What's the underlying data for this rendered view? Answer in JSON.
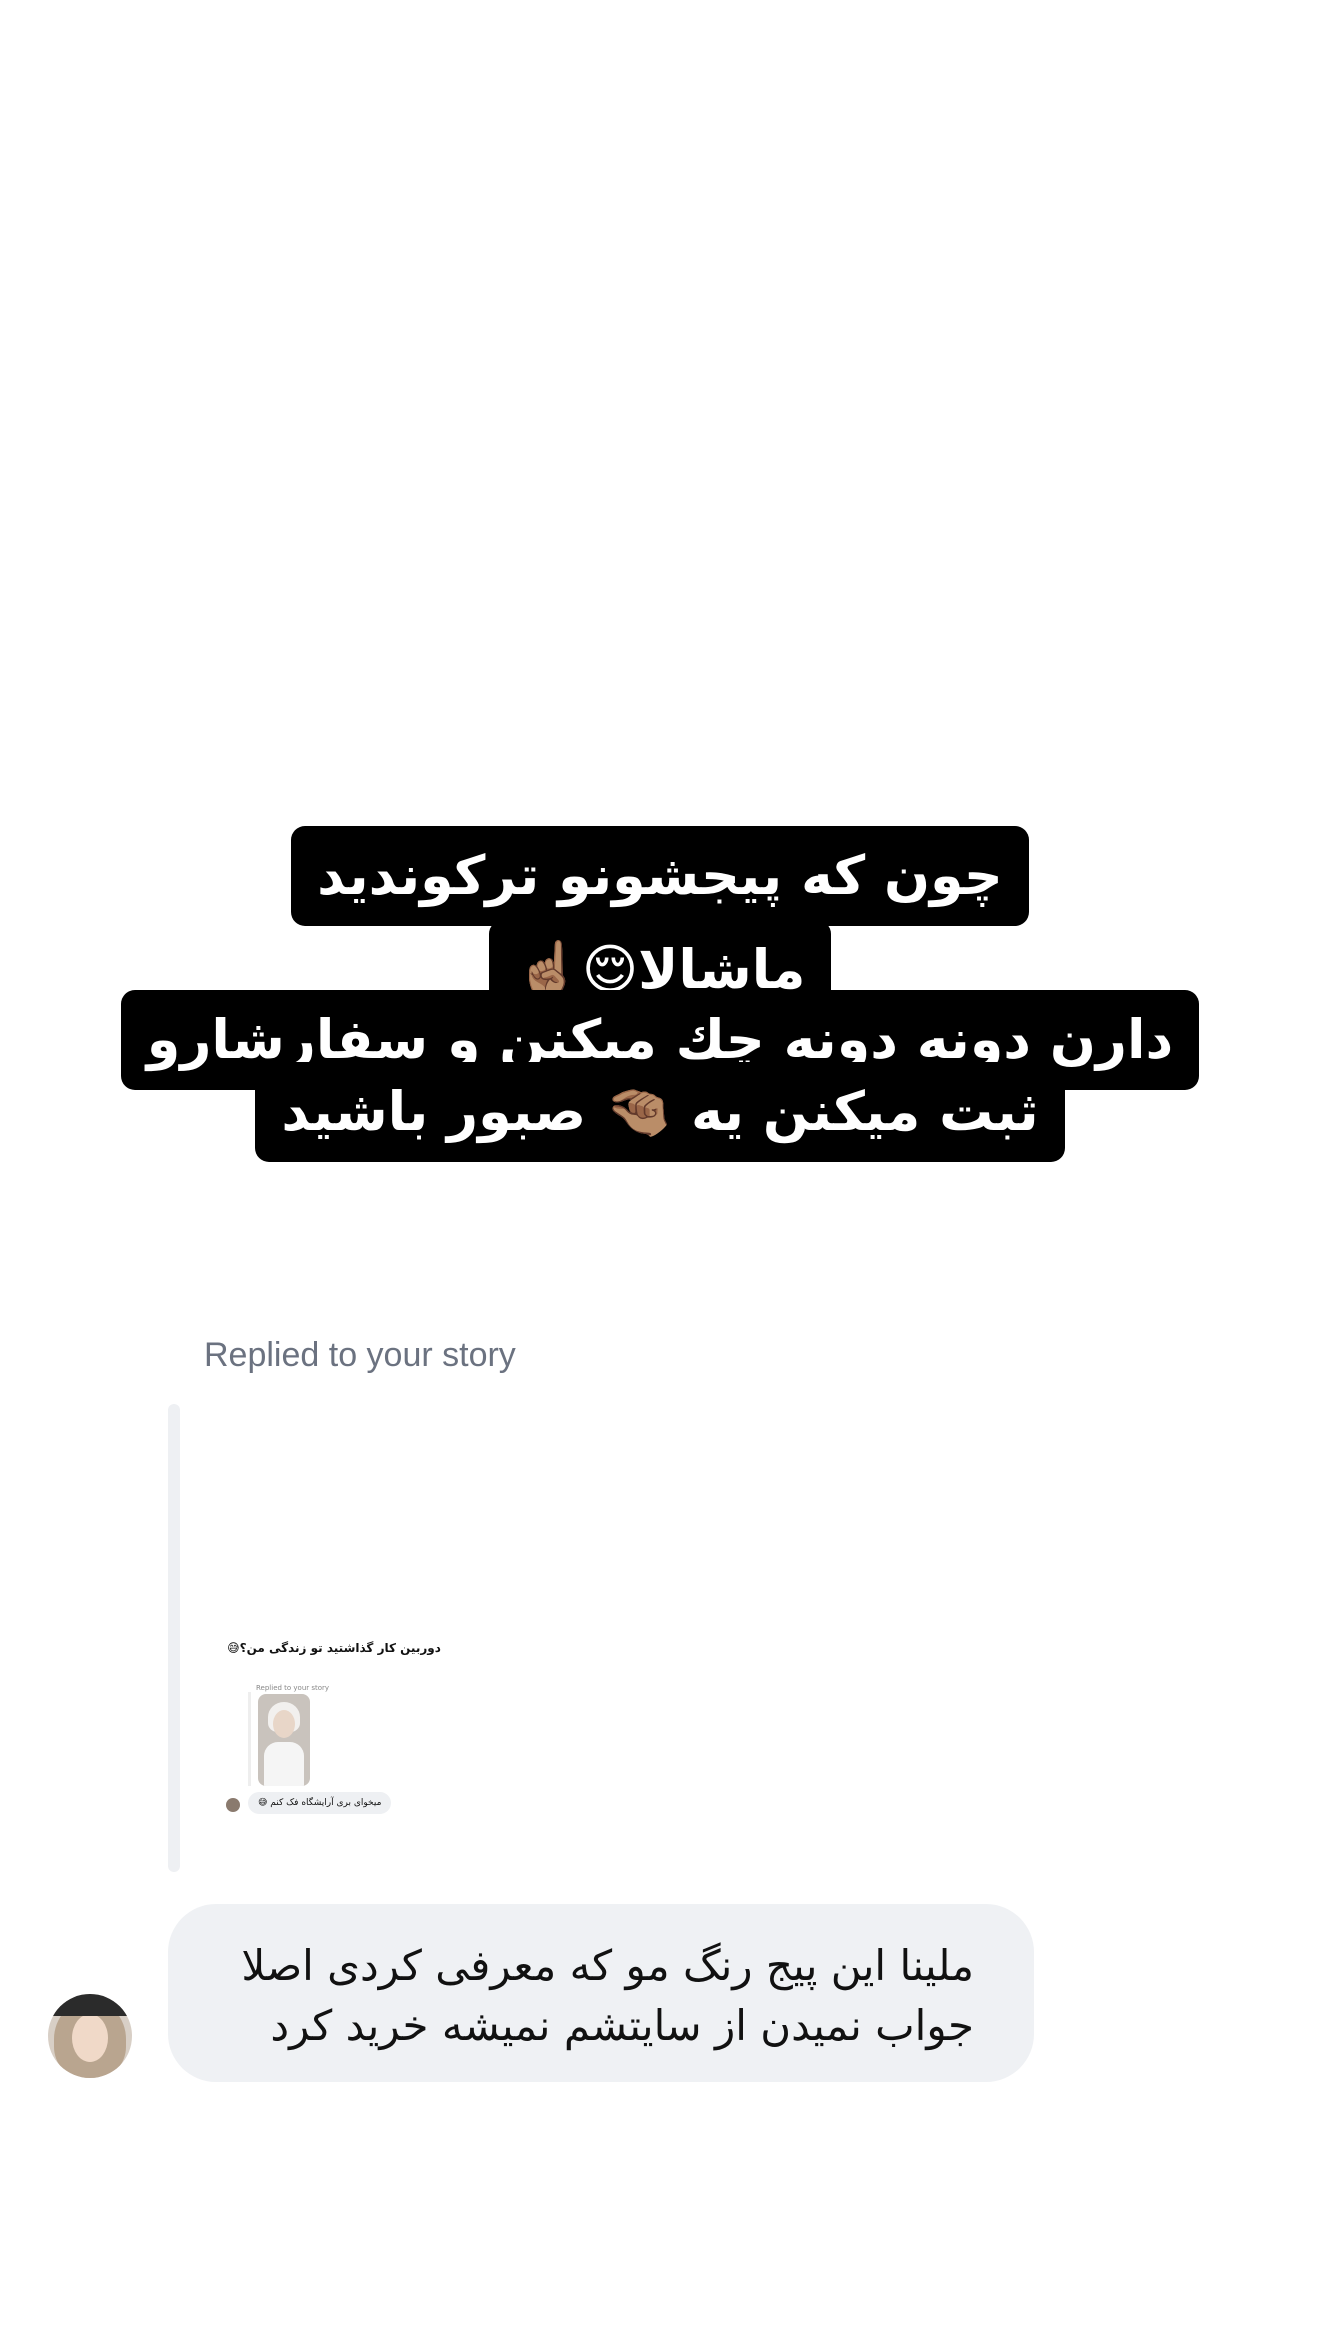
{
  "story_caption": {
    "lines": [
      "چون که پیجشونو ترکوندید",
      "ماشالا😌☝🏽",
      "دارن دونه دونه چك میکنن و سفارشارو",
      "ثبت میکنن یه 🤏🏽 صبور باشید"
    ]
  },
  "reply_label": "Replied to your story",
  "story_preview": {
    "caption": "دوربین کار گذاشتید تو زندگی من؟😅",
    "reply_label": "Replied to your story",
    "message": "میخوای بری آرایشگاه فک کنم 😅"
  },
  "message": {
    "lines": [
      "ملینا این پیج رنگ مو که معرفی کردی اصلا",
      "جواب نمیدن از سایتشم نمیشه خرید کرد"
    ]
  }
}
